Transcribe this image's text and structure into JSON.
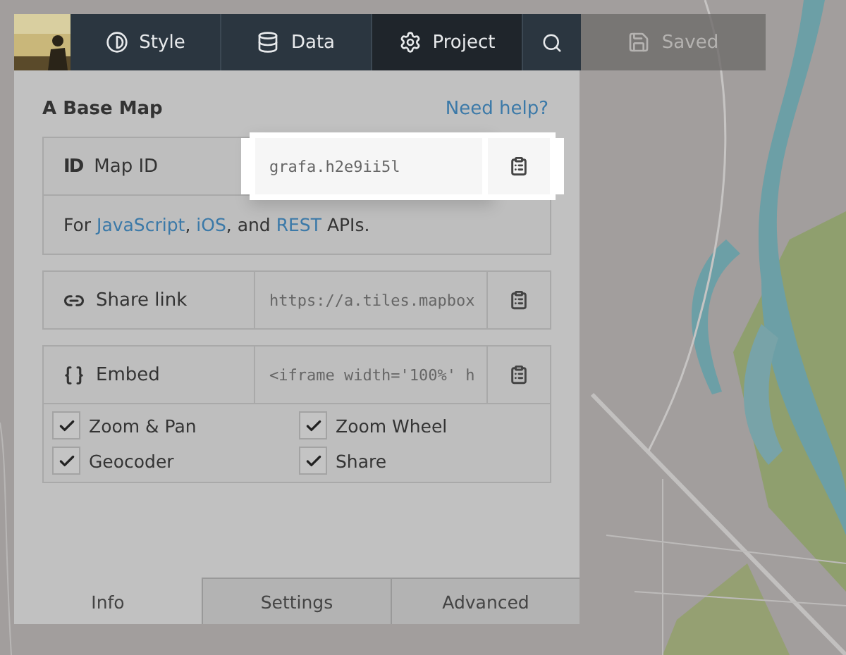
{
  "toolbar": {
    "tabs": [
      {
        "label": "Style",
        "selected": false
      },
      {
        "label": "Data",
        "selected": false
      },
      {
        "label": "Project",
        "selected": true
      }
    ],
    "status": "Saved"
  },
  "panel": {
    "title": "A Base Map",
    "help_link": "Need help?",
    "fields": [
      {
        "kind": "id",
        "icon_text": "ID",
        "label": "Map ID",
        "value": "grafa.h2e9ii5l",
        "highlighted": true,
        "description": [
          {
            "kind": "text",
            "text": "For "
          },
          {
            "kind": "link",
            "text": "JavaScript"
          },
          {
            "kind": "text",
            "text": ", "
          },
          {
            "kind": "link",
            "text": "iOS"
          },
          {
            "kind": "text",
            "text": ", and "
          },
          {
            "kind": "link",
            "text": "REST"
          },
          {
            "kind": "text",
            "text": " APIs."
          }
        ]
      },
      {
        "kind": "link",
        "label": "Share link",
        "value": "https://a.tiles.mapbox",
        "highlighted": false
      },
      {
        "kind": "embed",
        "label": "Embed",
        "value": "<iframe width='100%' h",
        "highlighted": false,
        "options": [
          {
            "label": "Zoom & Pan",
            "checked": true
          },
          {
            "label": "Zoom Wheel",
            "checked": true
          },
          {
            "label": "Geocoder",
            "checked": true
          },
          {
            "label": "Share",
            "checked": true
          }
        ]
      }
    ],
    "tabs": [
      {
        "label": "Info",
        "selected": true
      },
      {
        "label": "Settings",
        "selected": false
      },
      {
        "label": "Advanced",
        "selected": false
      }
    ]
  }
}
